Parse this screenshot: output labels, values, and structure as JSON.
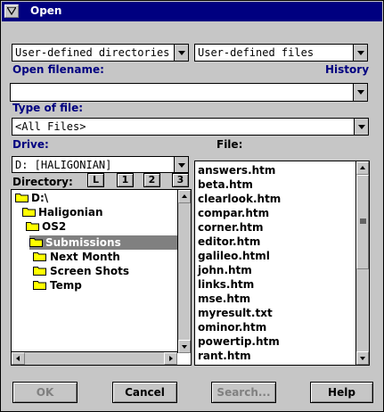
{
  "window": {
    "title": "Open"
  },
  "combos": {
    "directories": "User-defined directories",
    "files": "User-defined files",
    "filename_value": "",
    "type_value": "<All Files>",
    "drive_value": "D:  [HALIGONIAN]"
  },
  "labels": {
    "open_filename": "Open filename:",
    "history": "History",
    "type_of_file": "Type of file:",
    "drive": "Drive:",
    "file": "File:",
    "directory": "Directory:"
  },
  "drive_buttons": [
    "L",
    "1",
    "2",
    "3"
  ],
  "directory_tree": [
    {
      "label": "D:\\",
      "selected": false
    },
    {
      "label": "Haligonian",
      "selected": false
    },
    {
      "label": "OS2",
      "selected": false
    },
    {
      "label": "Submissions",
      "selected": true
    },
    {
      "label": "Next Month",
      "selected": false
    },
    {
      "label": "Screen Shots",
      "selected": false
    },
    {
      "label": "Temp",
      "selected": false
    }
  ],
  "files": [
    "answers.htm",
    "beta.htm",
    "clearlook.htm",
    "compar.htm",
    "corner.htm",
    "editor.htm",
    "galileo.html",
    "john.htm",
    "links.htm",
    "mse.htm",
    "myresult.txt",
    "ominor.htm",
    "powertip.htm",
    "rant.htm"
  ],
  "buttons": {
    "ok": "OK",
    "cancel": "Cancel",
    "search": "Search...",
    "help": "Help"
  },
  "colors": {
    "title_bar": "#000080",
    "label": "#000080",
    "selection": "#808080",
    "folder": "#ffff00"
  }
}
